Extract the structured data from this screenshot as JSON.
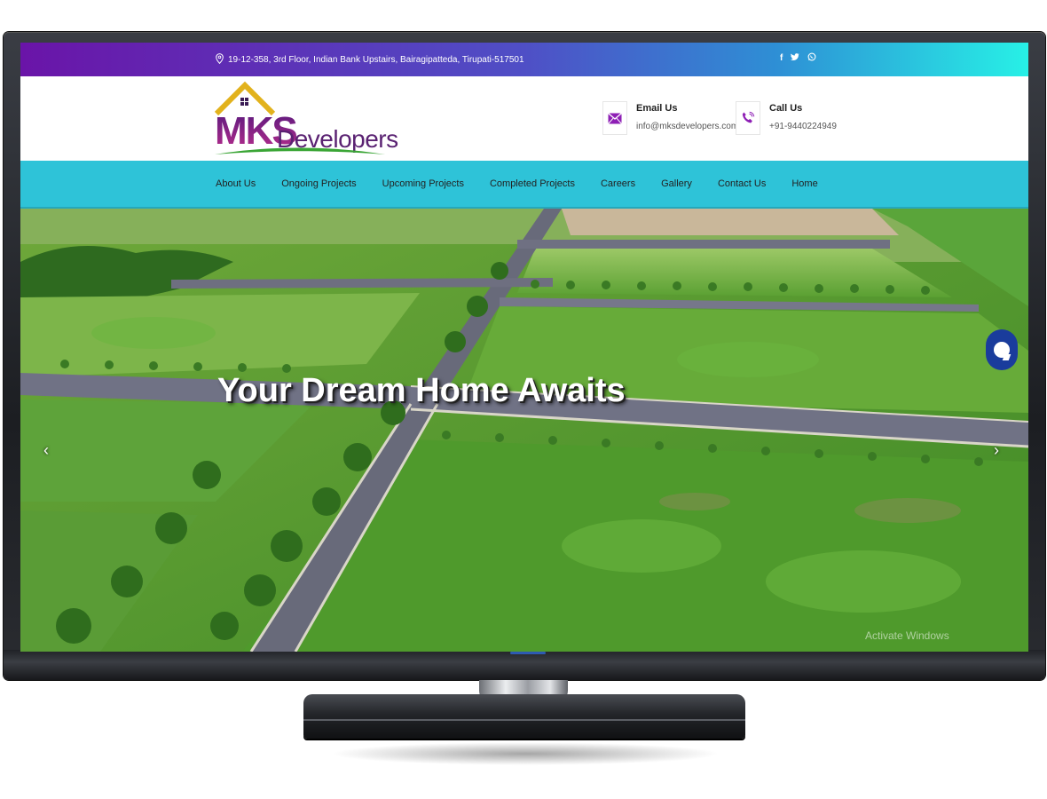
{
  "topbar": {
    "address": "19-12-358, 3rd Floor, Indian Bank Upstairs, Bairagipatteda, Tirupati-517501",
    "social": [
      {
        "icon": "facebook-icon",
        "glyph": "f"
      },
      {
        "icon": "twitter-icon",
        "glyph": "t"
      },
      {
        "icon": "whatsapp-icon",
        "glyph": "w"
      }
    ]
  },
  "logo": {
    "mark": "MKS",
    "name": "Developers"
  },
  "contact": {
    "email_title": "Email Us",
    "email_value": "info@mksdevelopers.com",
    "call_title": "Call Us",
    "call_value": "+91-9440224949"
  },
  "nav": {
    "items": [
      "About Us",
      "Ongoing Projects",
      "Upcoming Projects",
      "Completed Projects",
      "Careers",
      "Gallery",
      "Contact Us",
      "Home"
    ]
  },
  "hero": {
    "title": "Your Dream Home Awaits",
    "prev_glyph": "‹",
    "next_glyph": "›",
    "watermark": "Activate Windows"
  },
  "colors": {
    "topbar_start": "#6a14a8",
    "topbar_end": "#27f0e6",
    "nav_bg": "#2ec3d8",
    "brand_purple": "#5d1a7e",
    "chat_bg": "#1a3c9c"
  }
}
